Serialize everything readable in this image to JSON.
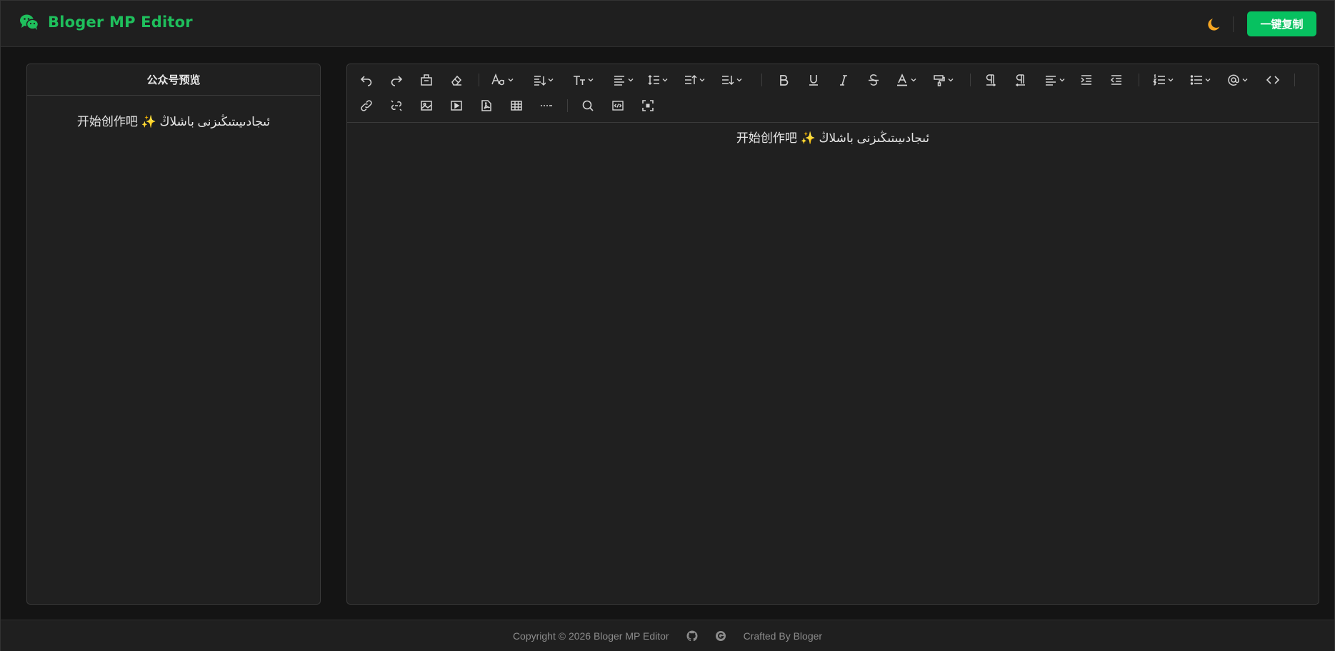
{
  "header": {
    "app_name": "Bloger MP Editor",
    "copy_button": "一键复制",
    "theme_icon": "moon-icon",
    "accent": "#07c160",
    "brand_color": "#1fbf5c"
  },
  "preview": {
    "title": "公众号预览",
    "content_zh": "开始创作吧",
    "content_sparkle": "✨",
    "content_ug": "ئىجادىيىتىڭىزنى باشلاڭ"
  },
  "editor": {
    "content_zh": "开始创作吧",
    "content_sparkle": "✨",
    "content_ug": "ئىجادىيىتىڭىزنى باشلاڭ",
    "toolbar_icons": [
      "undo-icon",
      "redo-icon",
      "clear-format-icon",
      "eraser-icon",
      "font-family-icon",
      "heading-icon",
      "font-size-icon",
      "align-icon",
      "line-height-icon",
      "space-before-icon",
      "space-after-icon",
      "bold-icon",
      "underline-icon",
      "italic-icon",
      "strikethrough-icon",
      "font-color-icon",
      "format-painter-icon",
      "ltr-paragraph-icon",
      "rtl-paragraph-icon",
      "text-align-icon",
      "indent-icon",
      "outdent-icon",
      "ordered-list-icon",
      "bullet-list-icon",
      "mention-icon",
      "code-icon",
      "link-icon",
      "unlink-icon",
      "image-icon",
      "video-icon",
      "pdf-icon",
      "table-icon",
      "divider-icon",
      "search-icon",
      "code-block-icon",
      "fullscreen-icon"
    ]
  },
  "footer": {
    "copyright": "Copyright © 2026 Bloger MP Editor",
    "crafted": "Crafted By Bloger",
    "icons": [
      "github-icon",
      "globe-icon"
    ]
  }
}
